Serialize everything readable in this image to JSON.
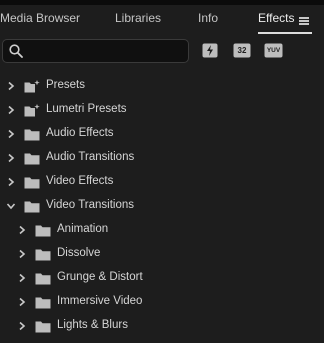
{
  "tabs": [
    {
      "label": "Media Browser"
    },
    {
      "label": "Libraries"
    },
    {
      "label": "Info"
    },
    {
      "label": "Effects"
    }
  ],
  "search": {
    "value": "",
    "placeholder": ""
  },
  "filters": [
    {
      "name": "accelerated-effects",
      "label": ""
    },
    {
      "name": "32-bit-color",
      "label": "32"
    },
    {
      "name": "yuv-effects",
      "label": "YUV"
    }
  ],
  "tree": {
    "items": [
      {
        "label": "Presets",
        "expanded": false,
        "icon": "preset-folder-icon"
      },
      {
        "label": "Lumetri Presets",
        "expanded": false,
        "icon": "preset-folder-icon"
      },
      {
        "label": "Audio Effects",
        "expanded": false,
        "icon": "folder-icon"
      },
      {
        "label": "Audio Transitions",
        "expanded": false,
        "icon": "folder-icon"
      },
      {
        "label": "Video Effects",
        "expanded": false,
        "icon": "folder-icon"
      },
      {
        "label": "Video Transitions",
        "expanded": true,
        "icon": "folder-icon",
        "children": [
          {
            "label": "Animation"
          },
          {
            "label": "Dissolve"
          },
          {
            "label": "Grunge & Distort"
          },
          {
            "label": "Immersive Video"
          },
          {
            "label": "Lights & Blurs"
          }
        ]
      }
    ]
  },
  "colors": {
    "background": "#1d1d1d",
    "text": "#d6d6d6",
    "icon": "#bdbdbd",
    "search_bg": "#101010"
  }
}
